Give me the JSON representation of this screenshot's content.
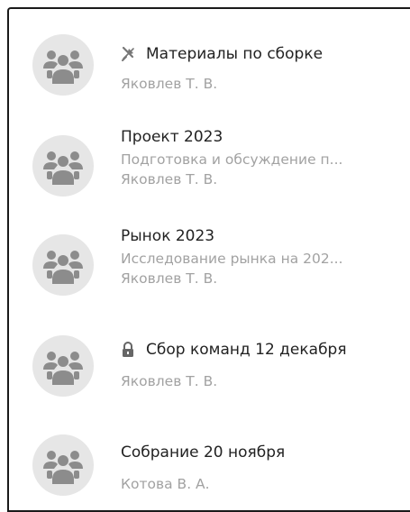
{
  "chats": [
    {
      "title": "Материалы по сборке",
      "icon": "pin-off-icon",
      "lines": [
        "Яковлев Т. В."
      ]
    },
    {
      "title": "Проект 2023",
      "lines": [
        "Подготовка и обсуждение п...",
        "Яковлев Т. В."
      ]
    },
    {
      "title": "Рынок 2023",
      "lines": [
        "Исследование рынка на 202...",
        "Яковлев Т. В."
      ]
    },
    {
      "title": "Сбор команд 12 декабря",
      "icon": "lock-icon",
      "lines": [
        "Яковлев Т. В."
      ]
    },
    {
      "title": "Собрание 20 ноября",
      "lines": [
        "Котова В. А."
      ]
    }
  ],
  "colors": {
    "avatar_bg": "#e6e6e6",
    "avatar_fg": "#8c8c8c",
    "title": "#222222",
    "subtitle": "#a2a2a2"
  }
}
